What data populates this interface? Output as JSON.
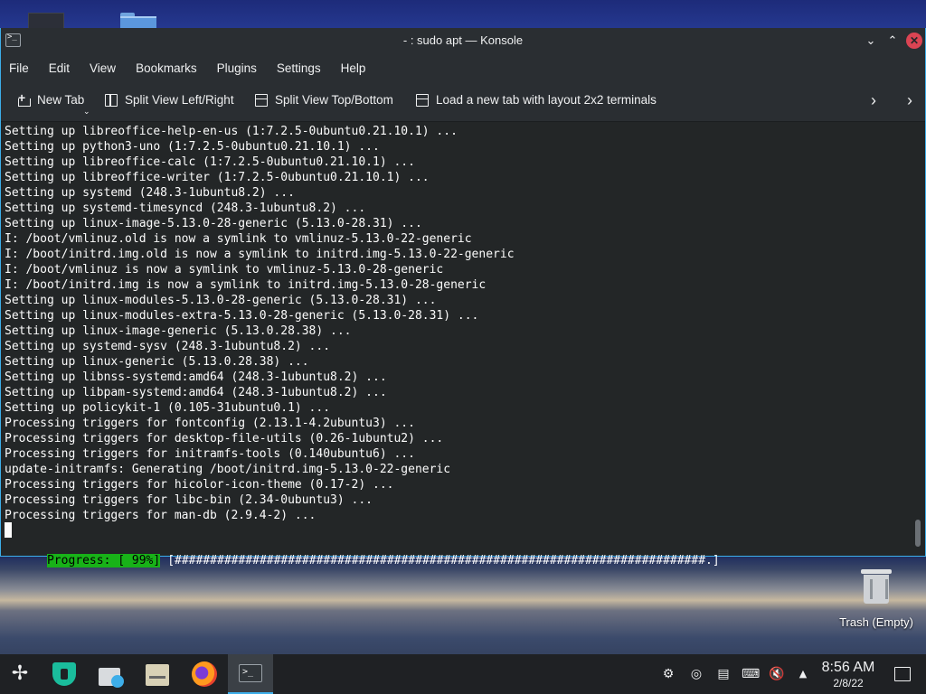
{
  "window": {
    "title": "- : sudo apt — Konsole",
    "minimize_glyph": "⌄",
    "maximize_glyph": "⌃",
    "close_glyph": "✕"
  },
  "menu": [
    "File",
    "Edit",
    "View",
    "Bookmarks",
    "Plugins",
    "Settings",
    "Help"
  ],
  "toolbar": {
    "new_tab": "New Tab",
    "split_lr": "Split View Left/Right",
    "split_tb": "Split View Top/Bottom",
    "layout_2x2": "Load a new tab with layout 2x2 terminals",
    "caret": "⌄",
    "next_glyph": "›",
    "overflow_glyph": "›"
  },
  "terminal": {
    "lines": [
      "Setting up libreoffice-help-en-us (1:7.2.5-0ubuntu0.21.10.1) ...",
      "Setting up python3-uno (1:7.2.5-0ubuntu0.21.10.1) ...",
      "Setting up libreoffice-calc (1:7.2.5-0ubuntu0.21.10.1) ...",
      "Setting up libreoffice-writer (1:7.2.5-0ubuntu0.21.10.1) ...",
      "Setting up systemd (248.3-1ubuntu8.2) ...",
      "Setting up systemd-timesyncd (248.3-1ubuntu8.2) ...",
      "Setting up linux-image-5.13.0-28-generic (5.13.0-28.31) ...",
      "I: /boot/vmlinuz.old is now a symlink to vmlinuz-5.13.0-22-generic",
      "I: /boot/initrd.img.old is now a symlink to initrd.img-5.13.0-22-generic",
      "I: /boot/vmlinuz is now a symlink to vmlinuz-5.13.0-28-generic",
      "I: /boot/initrd.img is now a symlink to initrd.img-5.13.0-28-generic",
      "Setting up linux-modules-5.13.0-28-generic (5.13.0-28.31) ...",
      "Setting up linux-modules-extra-5.13.0-28-generic (5.13.0-28.31) ...",
      "Setting up linux-image-generic (5.13.0.28.38) ...",
      "Setting up systemd-sysv (248.3-1ubuntu8.2) ...",
      "Setting up linux-generic (5.13.0.28.38) ...",
      "Setting up libnss-systemd:amd64 (248.3-1ubuntu8.2) ...",
      "Setting up libpam-systemd:amd64 (248.3-1ubuntu8.2) ...",
      "Setting up policykit-1 (0.105-31ubuntu0.1) ...",
      "Processing triggers for fontconfig (2.13.1-4.2ubuntu3) ...",
      "Processing triggers for desktop-file-utils (0.26-1ubuntu2) ...",
      "Processing triggers for initramfs-tools (0.140ubuntu6) ...",
      "update-initramfs: Generating /boot/initrd.img-5.13.0-22-generic",
      "Processing triggers for hicolor-icon-theme (0.17-2) ...",
      "Processing triggers for libc-bin (2.34-0ubuntu3) ...",
      "Processing triggers for man-db (2.9.4-2) ..."
    ],
    "progress_label": "Progress: [ 99%]",
    "progress_bar": "[###########################################################################.]",
    "progress_percent": 99
  },
  "desktop": {
    "trash_label": "Trash (Empty)"
  },
  "taskbar": {
    "launcher_glyph": "✢",
    "terminal_glyph": ">_",
    "tray": {
      "steam_glyph": "⚙",
      "update_glyph": "◎",
      "clipboard_glyph": "▤",
      "keyboard_glyph": "⌨",
      "volume_glyph": "🔇",
      "expand_glyph": "▲"
    },
    "clock_time": "8:56 AM",
    "clock_date": "2/8/22"
  },
  "colors": {
    "accent": "#3daee9",
    "progress_green": "#18b218",
    "close_red": "#da4453"
  }
}
